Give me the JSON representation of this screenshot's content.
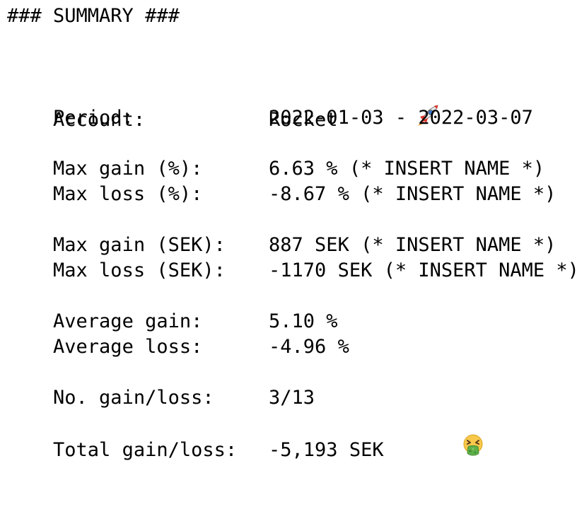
{
  "summary": {
    "header": "### SUMMARY ###",
    "rows": [
      {
        "label": "Account:",
        "value": "Rocket",
        "emoji": "rocket-icon"
      },
      {
        "label": "Period:",
        "value": "2022-01-03 - 2022-03-07"
      },
      {
        "label": "Max gain (%):",
        "value": "6.63 % (* INSERT NAME *)"
      },
      {
        "label": "Max loss (%):",
        "value": "-8.67 % (* INSERT NAME *)"
      },
      {
        "label": "Max gain (SEK):",
        "value": "887 SEK (* INSERT NAME *)"
      },
      {
        "label": "Max loss (SEK):",
        "value": "-1170 SEK (* INSERT NAME *)"
      },
      {
        "label": "Average gain:",
        "value": "5.10 %"
      },
      {
        "label": "Average loss:",
        "value": "-4.96 %"
      },
      {
        "label": "No. gain/loss:",
        "value": "3/13"
      },
      {
        "label": "Total gain/loss:",
        "value": "-5,193 SEK",
        "emoji": "vomiting-face-icon"
      }
    ]
  }
}
